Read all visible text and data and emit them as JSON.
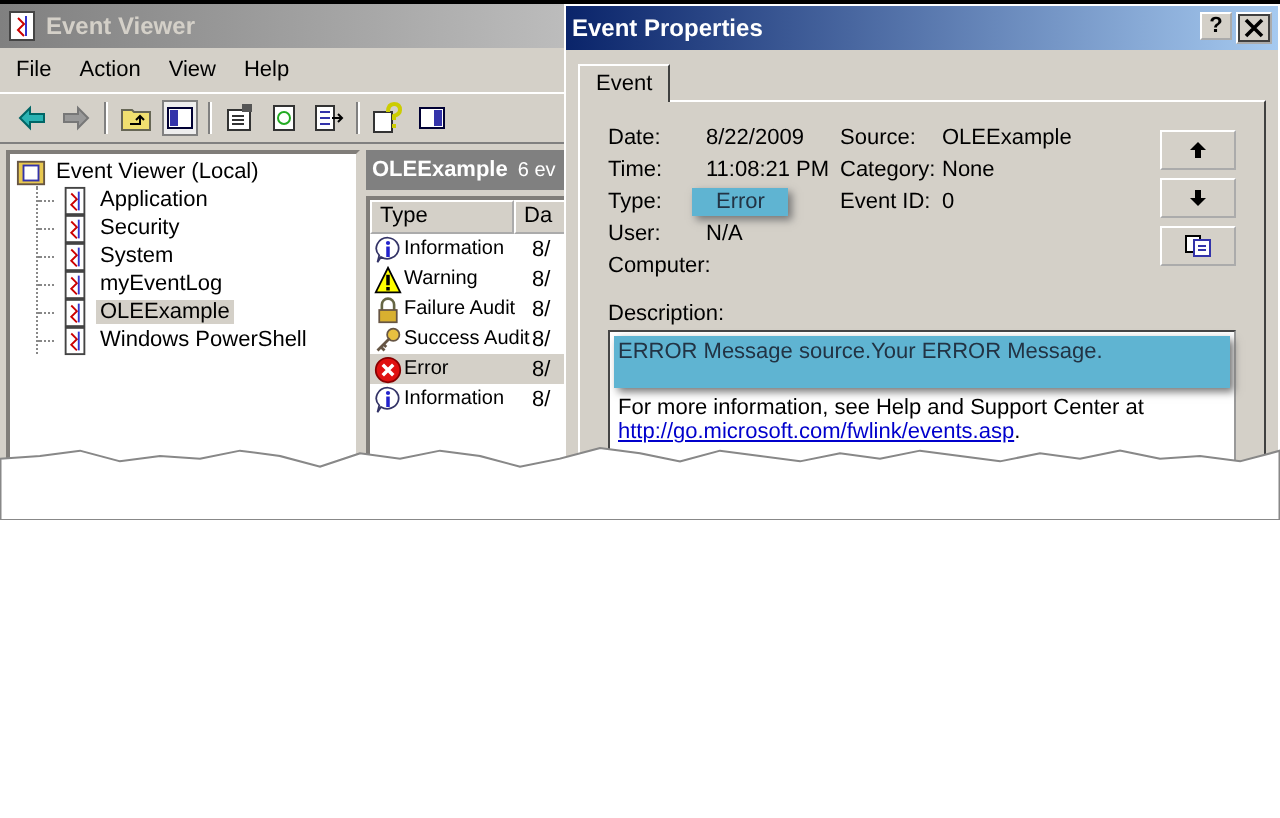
{
  "main_window": {
    "title": "Event Viewer",
    "menu": [
      "File",
      "Action",
      "View",
      "Help"
    ],
    "tree": {
      "label": "Event Viewer (Local)",
      "children": [
        {
          "label": "Application",
          "selected": false
        },
        {
          "label": "Security",
          "selected": false
        },
        {
          "label": "System",
          "selected": false
        },
        {
          "label": "myEventLog",
          "selected": false
        },
        {
          "label": "OLEExample",
          "selected": true
        },
        {
          "label": "Windows PowerShell",
          "selected": false
        }
      ]
    },
    "list": {
      "title": "OLEExample",
      "count": "6 ev",
      "columns": [
        "Type",
        "Da"
      ],
      "rows": [
        {
          "kind": "information",
          "type": "Information",
          "date": "8/",
          "selected": false
        },
        {
          "kind": "warning",
          "type": "Warning",
          "date": "8/",
          "selected": false
        },
        {
          "kind": "failure_audit",
          "type": "Failure Audit",
          "date": "8/",
          "selected": false
        },
        {
          "kind": "success_audit",
          "type": "Success Audit",
          "date": "8/",
          "selected": false
        },
        {
          "kind": "error",
          "type": "Error",
          "date": "8/",
          "selected": true
        },
        {
          "kind": "information",
          "type": "Information",
          "date": "8/",
          "selected": false
        }
      ]
    }
  },
  "dialog": {
    "title": "Event Properties",
    "help_button": "?",
    "tabs": [
      {
        "label": "Event",
        "selected": true
      }
    ],
    "left_fields": [
      {
        "label": "Date:",
        "value": "8/22/2009"
      },
      {
        "label": "Time:",
        "value": "11:08:21 PM"
      },
      {
        "label": "Type:",
        "value": "Error",
        "highlighted": true
      },
      {
        "label": "User:",
        "value": "N/A"
      },
      {
        "label": "Computer:"
      }
    ],
    "right_fields": [
      {
        "label": "Source:",
        "value": "OLEExample"
      },
      {
        "label": "Category:",
        "value": "None"
      },
      {
        "label": "Event ID:",
        "value": "0"
      }
    ],
    "description": {
      "label": "Description:",
      "message": "ERROR Message source.Your ERROR Message.",
      "highlighted": true,
      "more_info": "For more information, see Help and Support Center at",
      "link": "http://go.microsoft.com/fwlink/events.asp",
      "after_link": "."
    }
  }
}
